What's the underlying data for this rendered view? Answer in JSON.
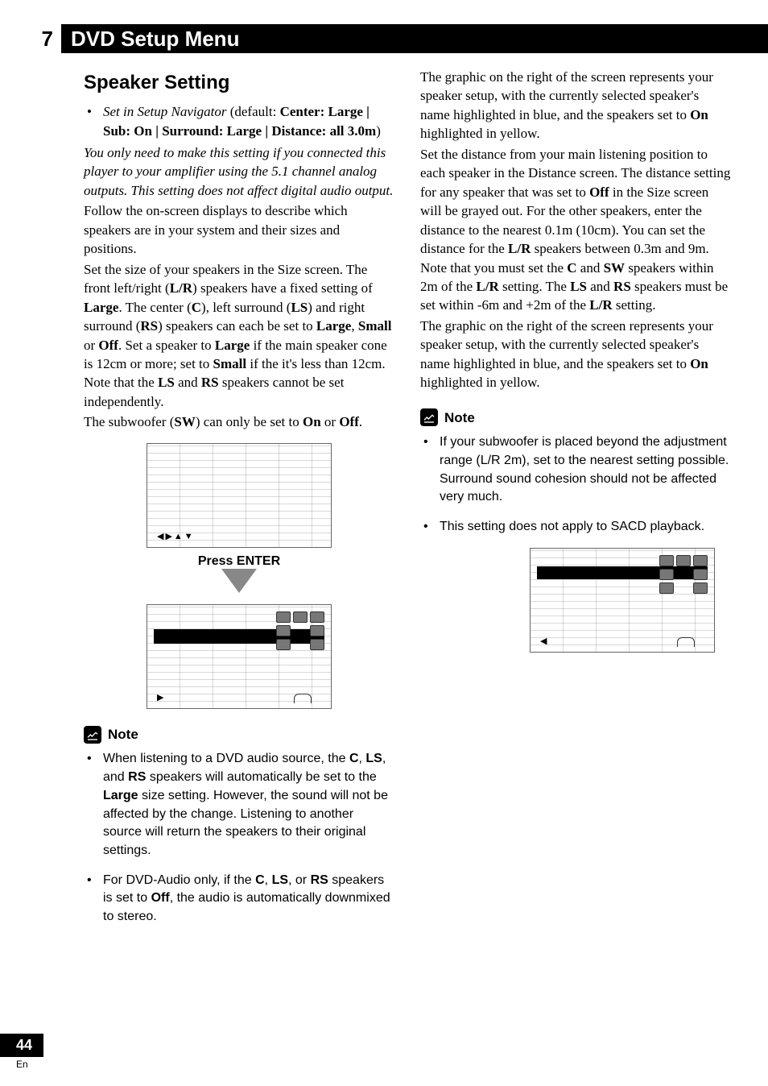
{
  "chapter": {
    "number": "7",
    "title": "DVD Setup Menu"
  },
  "section_heading": "Speaker Setting",
  "default_bullet": {
    "lead": "Set in Setup Navigator",
    "default_word": " (default: ",
    "defaults": "Center: Large | Sub: On | Surround: Large | Distance: all 3.0m",
    "close": ")"
  },
  "left": {
    "p1": "You only need to make this setting if you connected this player to your amplifier using the 5.1 channel analog outputs. This setting does not affect digital audio output.",
    "p2": "Follow the on-screen displays to describe which speakers are in your system and their sizes and positions.",
    "p3a": "Set the size of your speakers in the Size screen. The front left/right (",
    "p3b": ") speakers have a fixed setting of ",
    "p3c": ". The center (",
    "p3d": "), left surround (",
    "p3e": ") and right surround (",
    "p3f": ") speakers can each be set to ",
    "p3g": ", ",
    "p3h": " or ",
    "p3i": ". Set a speaker to ",
    "p3j": " if the main speaker cone is 12cm or more; set to ",
    "p3k": " if the it's less than 12cm. Note that the ",
    "p3l": " and ",
    "p3m": " speakers cannot be set independently.",
    "p4a": "The subwoofer (",
    "p4b": ") can only be set to ",
    "p4c": " or ",
    "p4d": ".",
    "tokens": {
      "LR": "L/R",
      "Large": "Large",
      "C": "C",
      "LS": "LS",
      "RS": "RS",
      "Small": "Small",
      "Off": "Off",
      "SW": "SW",
      "On": "On"
    },
    "press_enter": "Press ENTER"
  },
  "right": {
    "p1a": "The graphic on the right of the screen represents your speaker setup, with the currently selected speaker's name highlighted in blue, and the speakers set to ",
    "p1b": " highlighted in yellow.",
    "p2a": "Set the distance from your main listening position to each speaker in the Distance screen. The distance setting for any speaker that was set to ",
    "p2b": " in the Size screen will be grayed out. For the other speakers, enter the distance to the nearest 0.1m (10cm). You can set the distance for the ",
    "p2c": " speakers between 0.3m and 9m. Note that you must set the ",
    "p2d": " and ",
    "p2e": " speakers within 2m of the ",
    "p2f": " setting. The ",
    "p2g": " and ",
    "p2h": " speakers must be set within -6m and +2m of the ",
    "p2i": " setting.",
    "p3a": "The graphic on the right of the screen represents your speaker setup, with the currently selected speaker's name highlighted in blue, and the speakers set to ",
    "p3b": " highlighted in yellow.",
    "tokens": {
      "On": "On",
      "Off": "Off",
      "LR": "L/R",
      "C": "C",
      "SW": "SW",
      "LS": "LS",
      "RS": "RS"
    }
  },
  "note_label": "Note",
  "note_left": {
    "i1a": "When listening to a DVD audio source, the ",
    "i1b": ", ",
    "i1c": ", and ",
    "i1d": " speakers will automatically be set to the ",
    "i1e": " size setting. However, the sound will not be affected by the change. Listening to another source will return the speakers to their original settings.",
    "i2a": "For DVD-Audio only, if the ",
    "i2b": ", ",
    "i2c": ", or ",
    "i2d": " speakers is set to ",
    "i2e": ", the audio is automatically downmixed to stereo.",
    "tokens": {
      "C": "C",
      "LS": "LS",
      "RS": "RS",
      "Large": "Large",
      "Off": "Off"
    }
  },
  "note_right": {
    "i1": "If your subwoofer is placed beyond the adjustment range (L/R  2m), set to the nearest setting possible. Surround sound cohesion should not be affected very much.",
    "i2": "This setting does not apply to SACD playback."
  },
  "footer": {
    "page": "44",
    "lang": "En"
  }
}
